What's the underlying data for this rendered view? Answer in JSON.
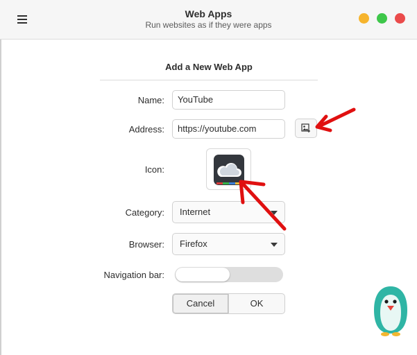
{
  "header": {
    "title": "Web Apps",
    "subtitle": "Run websites as if they were apps",
    "menu_icon": "hamburger-menu-icon",
    "window_buttons": [
      {
        "name": "minimize",
        "color": "#f6b42d"
      },
      {
        "name": "maximize",
        "color": "#3ec74a"
      },
      {
        "name": "close",
        "color": "#ea4b4b"
      }
    ]
  },
  "form": {
    "heading": "Add a New Web App",
    "name_label": "Name:",
    "name_value": "YouTube",
    "address_label": "Address:",
    "address_value": "https://youtube.com",
    "address_button_icon": "image-picker-icon",
    "icon_label": "Icon:",
    "icon_preview": "cloud-app-icon",
    "category_label": "Category:",
    "category_value": "Internet",
    "browser_label": "Browser:",
    "browser_value": "Firefox",
    "navbar_label": "Navigation bar:",
    "navbar_enabled": false,
    "cancel_label": "Cancel",
    "ok_label": "OK"
  },
  "annotations": {
    "arrow_color": "#e01010"
  },
  "mascot_icon": "penguin-mascot-icon"
}
